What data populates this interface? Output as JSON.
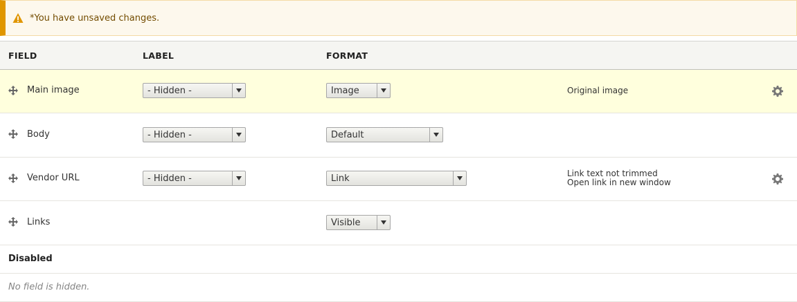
{
  "warning": {
    "text": "*You have unsaved changes."
  },
  "header": {
    "field": "FIELD",
    "label": "LABEL",
    "format": "FORMAT"
  },
  "rows": [
    {
      "name": "Main image",
      "label": "- Hidden -",
      "format": "Image",
      "summary": [
        "Original image"
      ],
      "has_settings": true,
      "highlighted": true
    },
    {
      "name": "Body",
      "label": "- Hidden -",
      "format": "Default",
      "summary": [],
      "has_settings": false,
      "highlighted": false
    },
    {
      "name": "Vendor URL",
      "label": "- Hidden -",
      "format": "Link",
      "summary": [
        "Link text not trimmed",
        "Open link in new window"
      ],
      "has_settings": true,
      "highlighted": false
    },
    {
      "name": "Links",
      "label": "",
      "format": "Visible",
      "summary": [],
      "has_settings": false,
      "highlighted": false
    }
  ],
  "disabled": {
    "title": "Disabled",
    "empty_text": "No field is hidden."
  },
  "icons": {
    "warning": "warning-icon",
    "drag": "move-icon",
    "settings": "gear-icon"
  },
  "colors": {
    "warning_border": "#e09600",
    "warning_bg": "#fdf8ed",
    "highlight_row": "#ffffdd"
  }
}
